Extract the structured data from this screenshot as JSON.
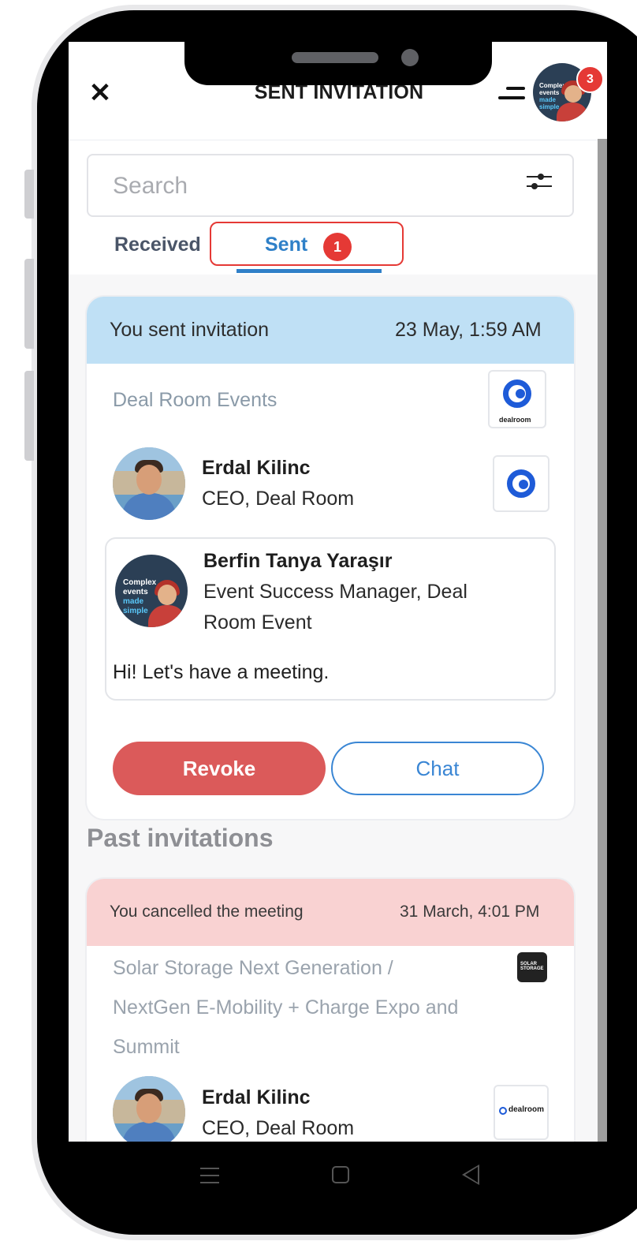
{
  "header": {
    "title": "SENT INVITATION",
    "notification_count": "3",
    "avatar_text_lines": [
      "Complex",
      "events",
      "made",
      "simple"
    ]
  },
  "search": {
    "placeholder": "Search"
  },
  "tabs": [
    {
      "label": "Received",
      "active": false
    },
    {
      "label": "Sent",
      "active": true,
      "badge": "1"
    }
  ],
  "current_invitation": {
    "status_text": "You sent invitation",
    "timestamp": "23 May, 1:59 AM",
    "event": "Deal Room Events",
    "logo_caption": "dealroom",
    "recipient": {
      "name": "Erdal Kilinc",
      "role": "CEO, Deal Room"
    },
    "sender": {
      "name": "Berfin Tanya Yaraşır",
      "role_line1": "Event Success Manager, Deal",
      "role_line2": "Room Event"
    },
    "message": "Hi! Let's have a meeting.",
    "actions": {
      "revoke": "Revoke",
      "chat": "Chat"
    }
  },
  "past_section_title": "Past invitations",
  "past_invitations": [
    {
      "status_text": "You cancelled the meeting",
      "timestamp": "31 March, 4:01 PM",
      "event_line1": "Solar Storage Next Generation /",
      "event_line2": "NextGen E-Mobility + Charge Expo and",
      "event_line3": "Summit",
      "logo_caption": "SOLAR STORAGE",
      "recipient": {
        "name": "Erdal Kilinc",
        "role": "CEO, Deal Room"
      },
      "wide_logo_text": "dealroom"
    }
  ],
  "colors": {
    "accent_blue": "#2f80c8",
    "sent_header": "#bfe0f5",
    "cancelled_header": "#f9d2d2",
    "revoke": "#db5a5a",
    "badge_red": "#e53935"
  }
}
